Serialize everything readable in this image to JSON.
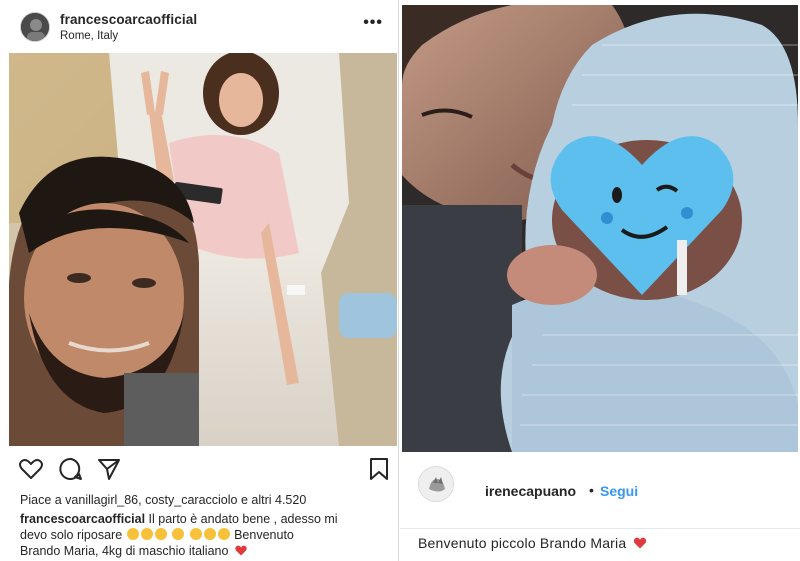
{
  "left_post": {
    "username": "francescoarcaofficial",
    "location": "Rome, Italy",
    "more_icon": "more-options-icon",
    "more_label": "•••",
    "photo_description_icon": "photo",
    "actions": {
      "like_icon": "heart-icon",
      "comment_icon": "comment-icon",
      "share_icon": "send-icon",
      "save_icon": "bookmark-icon"
    },
    "likes_text": "Piace a vanillagirl_86, costy_caracciolo e altri 4.520",
    "caption": {
      "username": "francescoarcaofficial",
      "line1": "Il parto è andato bene , adesso mi",
      "line2_a": "devo solo riposare",
      "line2_b": "Benvenuto",
      "line3": "Brando Maria, 4kg di maschio italiano"
    }
  },
  "right_post": {
    "username": "irenecapuano",
    "separator": "•",
    "follow_label": "Segui",
    "caption": "Benvenuto piccolo Brando Maria"
  },
  "colors": {
    "text": "#262626",
    "follow_blue": "#3897f0",
    "heart_red": "#e0393e",
    "heart_sticker_blue": "#5dbfee",
    "emoji_yellow": "#f7c23a"
  }
}
